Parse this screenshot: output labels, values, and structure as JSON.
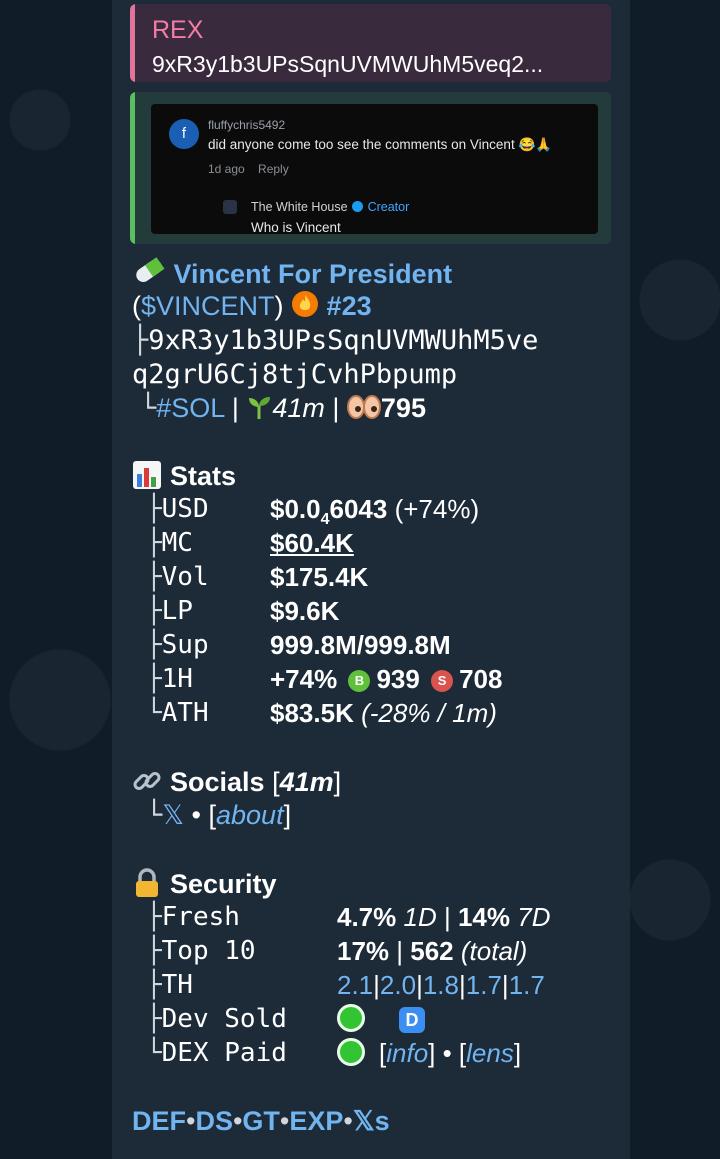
{
  "reply": {
    "name": "REX",
    "text": "9xR3y1b3UPsSqnUVMWUhM5veq2..."
  },
  "screenshot": {
    "avatar_letter": "f",
    "username": "fluffychris5492",
    "comment": "did anyone come too see the comments on Vincent 😂🙏",
    "time": "1d ago",
    "reply_label": "Reply",
    "reply_author": "The White House",
    "creator_label": "Creator",
    "reply_text": "Who is Vincent"
  },
  "token": {
    "name": "Vincent For President",
    "ticker": "$VINCENT",
    "rank": "#23",
    "address_line1": "9xR3y1b3UPsSqnUVMWUhM5ve",
    "address_line2": "q2grU6Cj8tjCvhPbpump",
    "chain": "#SOL",
    "age": "41m",
    "views": "795"
  },
  "stats": {
    "header": "Stats",
    "usd_key": "USD",
    "usd_prefix": "$0.0",
    "usd_sub": "4",
    "usd_rest": "6043",
    "usd_change": "(+74%)",
    "mc_key": "MC",
    "mc_value": "$60.4K",
    "vol_key": "Vol",
    "vol_value": "$175.4K",
    "lp_key": "LP",
    "lp_value": "$9.6K",
    "sup_key": "Sup",
    "sup_value": "999.8M/999.8M",
    "h1_key": "1H",
    "h1_change": "+74%",
    "buys": "939",
    "sells": "708",
    "ath_key": "ATH",
    "ath_value": "$83.5K",
    "ath_detail": "(-28% / 1m)"
  },
  "socials": {
    "header": "Socials",
    "age": "41m",
    "x_label": "𝕏",
    "about_label": "about"
  },
  "security": {
    "header": "Security",
    "fresh_key": "Fresh",
    "fresh_1d": "4.7%",
    "fresh_1d_label": "1D",
    "fresh_7d": "14%",
    "fresh_7d_label": "7D",
    "top10_key": "Top 10",
    "top10_pct": "17%",
    "top10_total": "562",
    "top10_total_label": "(total)",
    "th_key": "TH",
    "th_values": [
      "2.1",
      "2.0",
      "1.8",
      "1.7",
      "1.7"
    ],
    "dev_key": "Dev Sold",
    "dev_badge": "D",
    "dex_key": "DEX Paid",
    "info_label": "info",
    "lens_label": "lens"
  },
  "footer": {
    "links": [
      "DEF",
      "DS",
      "GT",
      "EXP",
      "𝕏s"
    ]
  },
  "colors": {
    "link": "#71b4f0",
    "bubble": "#1d2a37",
    "reply_accent": "#e07599",
    "quote_accent": "#5bbf5f"
  }
}
